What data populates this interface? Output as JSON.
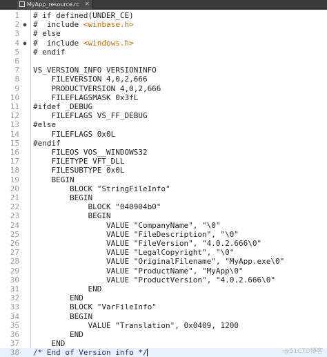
{
  "tab": {
    "title": "MyApp_resource.rc",
    "close_glyph": "×"
  },
  "watermark": "@51CTO博客",
  "lines": [
    {
      "n": "1",
      "fold": "",
      "segs": [
        {
          "t": "# if defined(UNDER_CE)",
          "c": ""
        }
      ]
    },
    {
      "n": "2",
      "fold": "●",
      "segs": [
        {
          "t": "#  include ",
          "c": ""
        },
        {
          "t": "<winbase.h>",
          "c": "str"
        }
      ]
    },
    {
      "n": "3",
      "fold": "",
      "segs": [
        {
          "t": "# else",
          "c": ""
        }
      ]
    },
    {
      "n": "4",
      "fold": "●",
      "segs": [
        {
          "t": "#  include ",
          "c": ""
        },
        {
          "t": "<windows.h>",
          "c": "str"
        }
      ]
    },
    {
      "n": "5",
      "fold": "",
      "segs": [
        {
          "t": "# endif",
          "c": ""
        }
      ]
    },
    {
      "n": "6",
      "fold": "",
      "segs": [
        {
          "t": "",
          "c": ""
        }
      ]
    },
    {
      "n": "7",
      "fold": "",
      "segs": [
        {
          "t": "VS_VERSION_INFO VERSIONINFO",
          "c": ""
        }
      ]
    },
    {
      "n": "8",
      "fold": "",
      "segs": [
        {
          "t": "    FILEVERSION 4,0,2,666",
          "c": ""
        }
      ]
    },
    {
      "n": "9",
      "fold": "",
      "segs": [
        {
          "t": "    PRODUCTVERSION 4,0,2,666",
          "c": ""
        }
      ]
    },
    {
      "n": "10",
      "fold": "",
      "segs": [
        {
          "t": "    FILEFLAGSMASK 0x3fL",
          "c": ""
        }
      ]
    },
    {
      "n": "11",
      "fold": "",
      "segs": [
        {
          "t": "#ifdef _DEBUG",
          "c": ""
        }
      ]
    },
    {
      "n": "12",
      "fold": "",
      "segs": [
        {
          "t": "    FILEFLAGS VS_FF_DEBUG",
          "c": ""
        }
      ]
    },
    {
      "n": "13",
      "fold": "",
      "segs": [
        {
          "t": "#else",
          "c": ""
        }
      ]
    },
    {
      "n": "14",
      "fold": "",
      "segs": [
        {
          "t": "    FILEFLAGS 0x0L",
          "c": ""
        }
      ]
    },
    {
      "n": "15",
      "fold": "",
      "segs": [
        {
          "t": "#endif",
          "c": ""
        }
      ]
    },
    {
      "n": "16",
      "fold": "",
      "segs": [
        {
          "t": "    FILEOS VOS__WINDOWS32",
          "c": ""
        }
      ]
    },
    {
      "n": "17",
      "fold": "",
      "segs": [
        {
          "t": "    FILETYPE VFT_DLL",
          "c": ""
        }
      ]
    },
    {
      "n": "18",
      "fold": "",
      "segs": [
        {
          "t": "    FILESUBTYPE 0x0L",
          "c": ""
        }
      ]
    },
    {
      "n": "19",
      "fold": "",
      "segs": [
        {
          "t": "    BEGIN",
          "c": ""
        }
      ]
    },
    {
      "n": "20",
      "fold": "",
      "segs": [
        {
          "t": "        BLOCK \"StringFileInfo\"",
          "c": ""
        }
      ]
    },
    {
      "n": "21",
      "fold": "",
      "segs": [
        {
          "t": "        BEGIN",
          "c": ""
        }
      ]
    },
    {
      "n": "22",
      "fold": "",
      "segs": [
        {
          "t": "            BLOCK \"040904b0\"",
          "c": ""
        }
      ]
    },
    {
      "n": "23",
      "fold": "",
      "segs": [
        {
          "t": "            BEGIN",
          "c": ""
        }
      ]
    },
    {
      "n": "24",
      "fold": "",
      "segs": [
        {
          "t": "                VALUE \"CompanyName\", \"\\0\"",
          "c": ""
        }
      ]
    },
    {
      "n": "25",
      "fold": "",
      "segs": [
        {
          "t": "                VALUE \"FileDescription\", \"\\0\"",
          "c": ""
        }
      ]
    },
    {
      "n": "26",
      "fold": "",
      "segs": [
        {
          "t": "                VALUE \"FileVersion\", \"4.0.2.666\\0\"",
          "c": ""
        }
      ]
    },
    {
      "n": "27",
      "fold": "",
      "segs": [
        {
          "t": "                VALUE \"LegalCopyright\", \"\\0\"",
          "c": ""
        }
      ]
    },
    {
      "n": "28",
      "fold": "",
      "segs": [
        {
          "t": "                VALUE \"OriginalFilename\", \"MyApp.exe\\0\"",
          "c": ""
        }
      ]
    },
    {
      "n": "29",
      "fold": "",
      "segs": [
        {
          "t": "                VALUE \"ProductName\", \"MyApp\\0\"",
          "c": ""
        }
      ]
    },
    {
      "n": "30",
      "fold": "",
      "segs": [
        {
          "t": "                VALUE \"ProductVersion\", \"4.0.2.666\\0\"",
          "c": ""
        }
      ]
    },
    {
      "n": "31",
      "fold": "",
      "segs": [
        {
          "t": "            END",
          "c": ""
        }
      ]
    },
    {
      "n": "32",
      "fold": "",
      "segs": [
        {
          "t": "        END",
          "c": ""
        }
      ]
    },
    {
      "n": "33",
      "fold": "",
      "segs": [
        {
          "t": "        BLOCK \"VarFileInfo\"",
          "c": ""
        }
      ]
    },
    {
      "n": "34",
      "fold": "",
      "segs": [
        {
          "t": "        BEGIN",
          "c": ""
        }
      ]
    },
    {
      "n": "35",
      "fold": "",
      "segs": [
        {
          "t": "            VALUE \"Translation\", 0x0409, 1200",
          "c": ""
        }
      ]
    },
    {
      "n": "36",
      "fold": "",
      "segs": [
        {
          "t": "        END",
          "c": ""
        }
      ]
    },
    {
      "n": "37",
      "fold": "",
      "segs": [
        {
          "t": "    END",
          "c": ""
        }
      ]
    },
    {
      "n": "38",
      "fold": "",
      "segs": [
        {
          "t": "/* End of Version info */",
          "c": "cm"
        }
      ]
    }
  ],
  "current_line": "38"
}
